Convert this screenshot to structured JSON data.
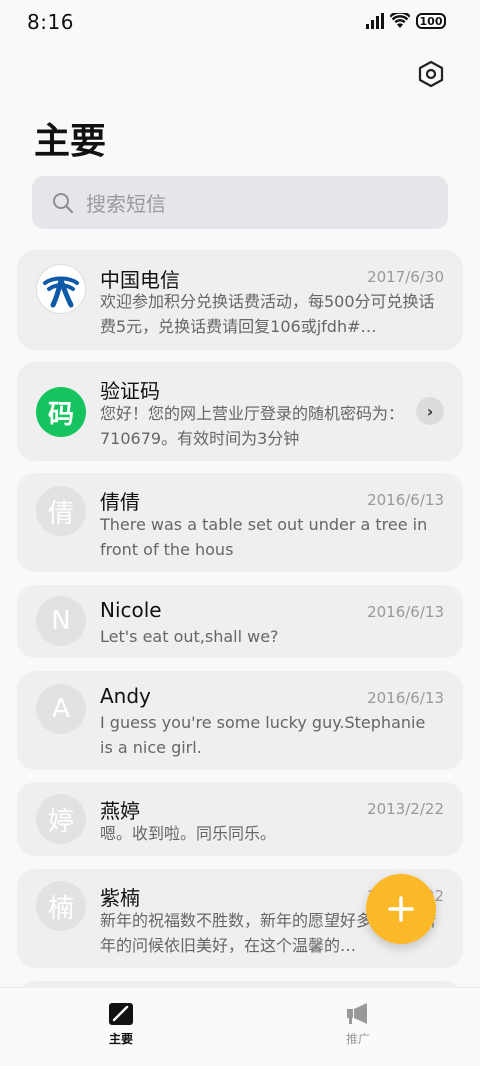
{
  "status": {
    "time": "8:16",
    "battery": "100"
  },
  "header": {
    "title": "主要"
  },
  "search": {
    "placeholder": "搜索短信"
  },
  "messages": [
    {
      "sender": "中国电信",
      "date": "2017/6/30",
      "preview": "欢迎参加积分兑换话费活动，每500分可兑换话费5元，兑换话费请回复106或jfdh#…",
      "avatar": "",
      "avatar_type": "logo"
    },
    {
      "sender": "验证码",
      "date": "",
      "preview": "您好！您的网上营业厅登录的随机密码为：710679。有效时间为3分钟",
      "avatar": "码",
      "avatar_type": "green"
    },
    {
      "sender": "倩倩",
      "date": "2016/6/13",
      "preview": "There was a table set out under a tree in front of the hous",
      "avatar": "倩",
      "avatar_type": "grey"
    },
    {
      "sender": "Nicole",
      "date": "2016/6/13",
      "preview": "Let's eat out,shall we?",
      "avatar": "N",
      "avatar_type": "grey"
    },
    {
      "sender": "Andy",
      "date": "2016/6/13",
      "preview": "I guess you're some lucky guy.Stephanie is a nice girl.",
      "avatar": "A",
      "avatar_type": "grey"
    },
    {
      "sender": "燕婷",
      "date": "2013/2/22",
      "preview": "嗯。收到啦。同乐同乐。",
      "avatar": "婷",
      "avatar_type": "grey"
    },
    {
      "sender": "紫楠",
      "date": "2013/2/22",
      "preview": "新年的祝福数不胜数，新年的愿望好多好多，新年的问候依旧美好，在这个温馨的…",
      "avatar": "楠",
      "avatar_type": "grey"
    }
  ],
  "tabs": [
    {
      "label": "主要"
    },
    {
      "label": "推广"
    }
  ],
  "colors": {
    "accent": "#fbb829",
    "verify_green": "#15c45e"
  }
}
